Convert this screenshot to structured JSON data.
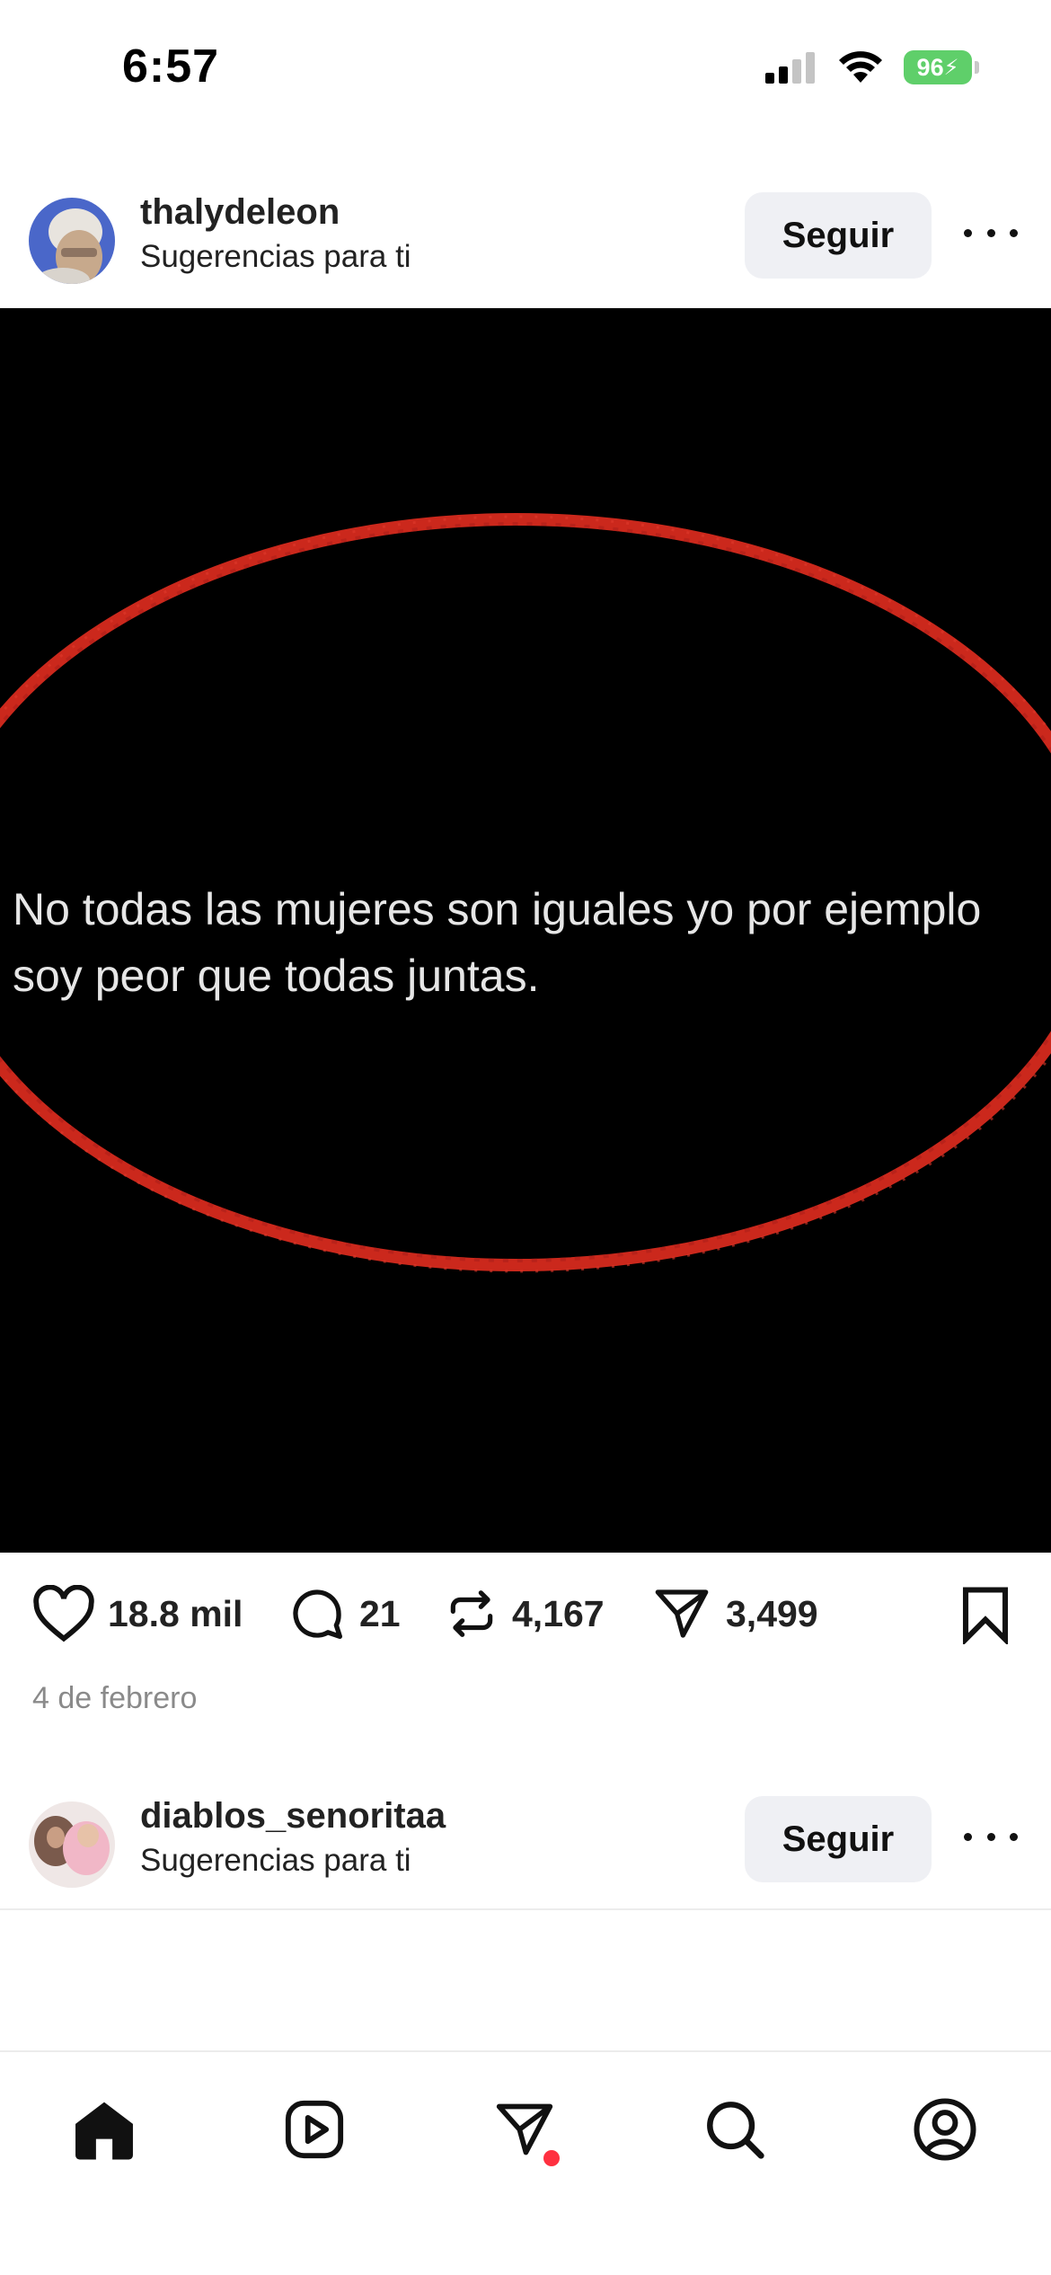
{
  "status_bar": {
    "time": "6:57",
    "battery": "96",
    "icons": [
      "cellular-signal-icon",
      "wifi-icon",
      "battery-charging-icon"
    ]
  },
  "posts": [
    {
      "username": "thalydeleon",
      "subtitle": "Sugerencias para ti",
      "follow_label": "Seguir",
      "image_text": "No todas las mujeres son iguales yo por ejemplo\nsoy peor que todas juntas.",
      "likes": "18.8 mil",
      "comments": "21",
      "reposts": "4,167",
      "shares": "3,499",
      "date": "4 de febrero"
    },
    {
      "username": "diablos_senoritaa",
      "subtitle": "Sugerencias para ti",
      "follow_label": "Seguir"
    }
  ],
  "bottom_nav": [
    "home-icon",
    "reels-icon",
    "messages-icon",
    "search-icon",
    "profile-icon"
  ],
  "colors": {
    "accent_red": "#d62a1e",
    "notification_dot": "#ff3040",
    "follow_button_bg": "#eff0f4",
    "battery_green": "#5fcf6a"
  }
}
